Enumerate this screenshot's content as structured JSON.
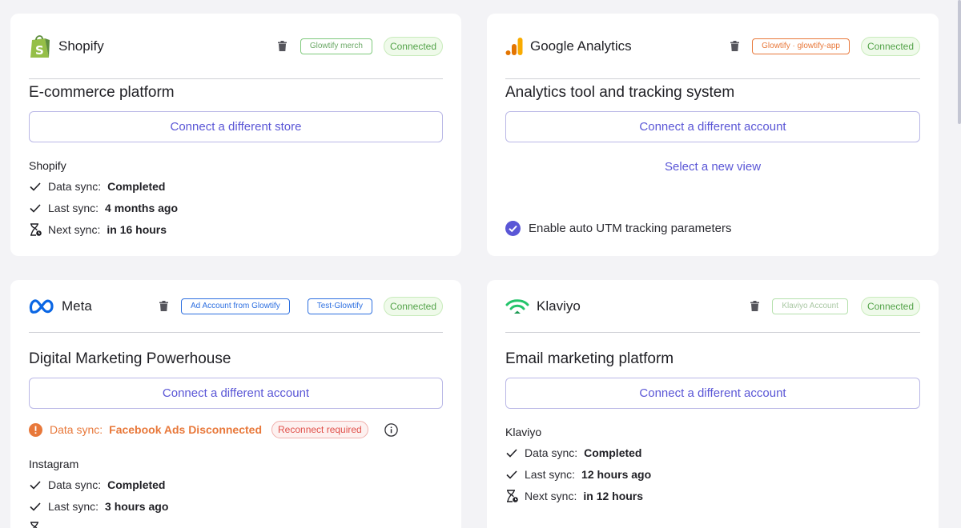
{
  "shopify": {
    "name": "Shopify",
    "tag": "Glowtify merch",
    "status": "Connected",
    "title": "E-commerce platform",
    "button": "Connect a different store",
    "section": "Shopify",
    "rows": [
      {
        "label": "Data sync:",
        "value": "Completed"
      },
      {
        "label": "Last sync:",
        "value": "4 months ago"
      },
      {
        "label": "Next sync:",
        "value": "in 16 hours"
      }
    ]
  },
  "google": {
    "name": "Google Analytics",
    "tag": "Glowtify · glowtify-app",
    "status": "Connected",
    "title": "Analytics tool and tracking system",
    "button": "Connect a different account",
    "link": "Select a new view",
    "utm": "Enable auto UTM tracking parameters"
  },
  "meta": {
    "name": "Meta",
    "tag1": "Ad Account from Glowtify",
    "tag2": "Test-Glowtify",
    "status": "Connected",
    "title": "Digital Marketing Powerhouse",
    "button": "Connect a different account",
    "error_label": "Data sync:",
    "error_value": "Facebook Ads Disconnected",
    "error_pill": "Reconnect required",
    "section": "Instagram",
    "rows": [
      {
        "label": "Data sync:",
        "value": "Completed"
      },
      {
        "label": "Last sync:",
        "value": "3 hours ago"
      }
    ]
  },
  "klaviyo": {
    "name": "Klaviyo",
    "tag": "Klaviyo Account",
    "status": "Connected",
    "title": "Email marketing platform",
    "button": "Connect a different account",
    "section": "Klaviyo",
    "rows": [
      {
        "label": "Data sync:",
        "value": "Completed"
      },
      {
        "label": "Last sync:",
        "value": "12 hours ago"
      },
      {
        "label": "Next sync:",
        "value": "in 12 hours"
      }
    ]
  },
  "icons": {
    "check": "check-icon",
    "hourglass": "hourglass-icon",
    "trash": "trash-icon",
    "info": "info-icon",
    "error": "error-icon"
  },
  "colors": {
    "accent": "#5a56d6",
    "connected": "#54a34a",
    "warning": "#e8783a"
  }
}
